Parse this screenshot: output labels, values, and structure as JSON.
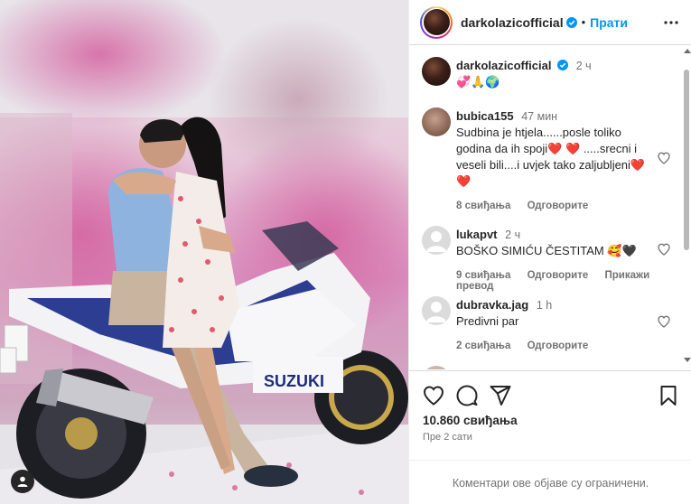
{
  "post": {
    "account": "darkolazicofficial",
    "follow_label": "Прати",
    "separator": "•",
    "caption_time": "2 ч",
    "caption_emoji": "💞🙏🌍",
    "photo_brand_text": "SUZUKI",
    "likes": "10.860 свиђања",
    "posted": "Пре 2 сати",
    "comments_limited": "Коментари ове објаве су ограничени."
  },
  "comments": [
    {
      "user": "bubica155",
      "time": "47 мин",
      "text": "Sudbina je htjela......posle toliko godina da ih spoji❤️ ❤️ .....srecni i veseli bili....i uvjek tako zaljubljeni❤️ ❤️",
      "likes": "8 свиђања",
      "reply": "Одговорите"
    },
    {
      "user": "lukapvt",
      "time": "2 ч",
      "text": "BOŠKO SIMIĆU ČESTITAM 🥰🖤",
      "likes": "9 свиђања",
      "reply": "Одговорите",
      "translate": "Прикажи превод"
    },
    {
      "user": "dubravka.jag",
      "time": "1 h",
      "text": "Predivni par",
      "likes": "2 свиђања",
      "reply": "Одговорите"
    }
  ],
  "colors": {
    "accent": "#0095f6",
    "text": "#262626",
    "muted": "#737373",
    "border": "#dbdbdb"
  },
  "icons": [
    "more-options-icon",
    "verified-badge-icon",
    "heart-icon",
    "comment-icon",
    "share-icon",
    "bookmark-icon",
    "user-tag-icon"
  ]
}
